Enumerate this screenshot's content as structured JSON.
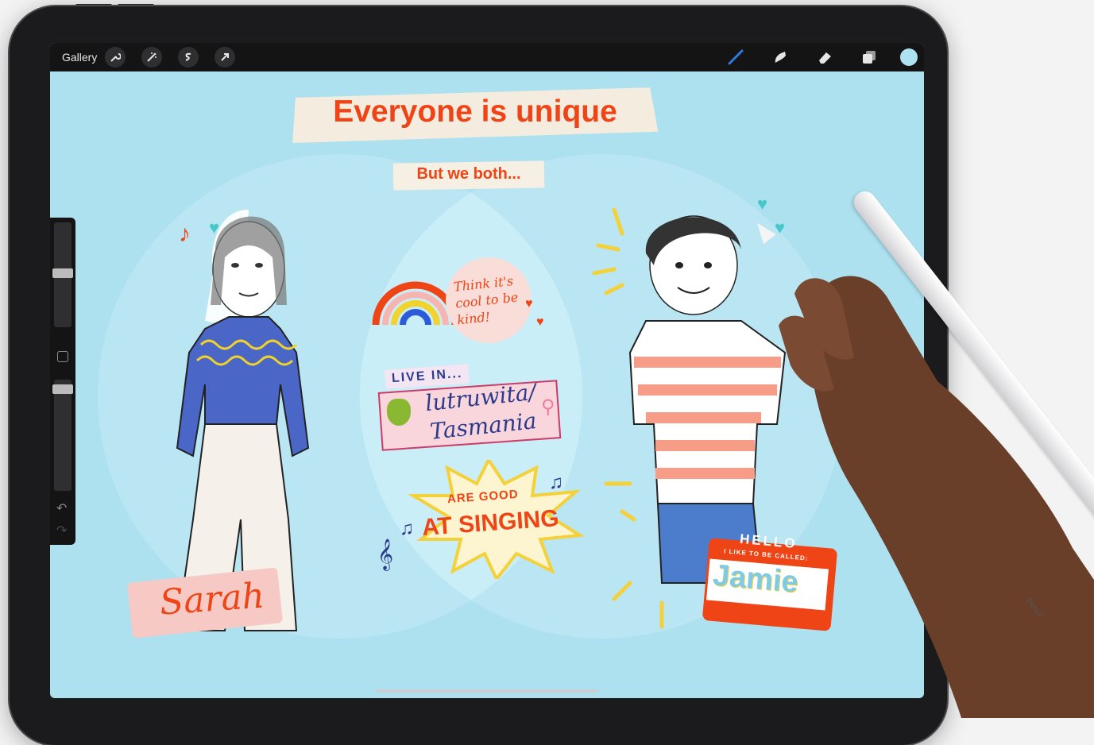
{
  "toolbar": {
    "gallery_label": "Gallery",
    "left_tools": [
      {
        "name": "actions-wrench-icon"
      },
      {
        "name": "adjustments-wand-icon"
      },
      {
        "name": "selection-s-icon"
      },
      {
        "name": "transform-arrow-icon"
      }
    ],
    "right_tools": [
      {
        "name": "brush-icon"
      },
      {
        "name": "smudge-icon"
      },
      {
        "name": "eraser-icon"
      },
      {
        "name": "layers-icon"
      }
    ],
    "active_color": "#aee2f2"
  },
  "canvas": {
    "title": "Everyone is unique",
    "subtitle": "But we both...",
    "person_left_name": "Sarah",
    "person_right_name": "Jamie",
    "name_tag_hello": "HELLO",
    "name_tag_prompt": "I LIKE TO BE CALLED:",
    "kind_text": "Think it's cool to be kind!",
    "live_in_label": "LIVE IN...",
    "place_line1": "lutruwita/",
    "place_line2": "Tasmania",
    "singing_line1": "ARE GOOD",
    "singing_line2": "AT SINGING"
  },
  "pencil": {
    "brand_text": "Pencil"
  },
  "colors": {
    "canvas_bg": "#ade1ef",
    "accent_red": "#ef4416",
    "toolbar_bg": "#141414",
    "brush_active": "#2f7be0"
  }
}
